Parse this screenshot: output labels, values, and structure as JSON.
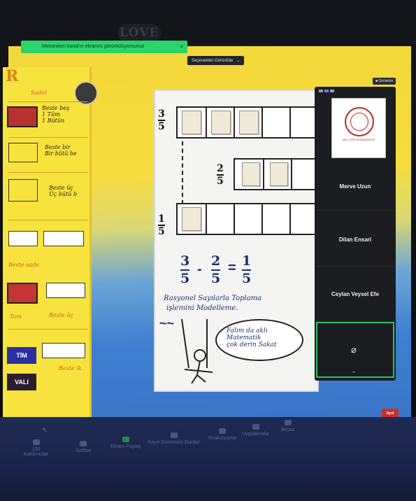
{
  "bezel": {
    "camera_label": "LOVE"
  },
  "zoom_bar": {
    "share_banner": "Mekaniken kanal'ın ekranını görüntülüyorsunuz",
    "share_banner_close": "×",
    "view_options": "Seçenekleri Görüntüle",
    "view_chevron": "⌄",
    "fullscreen_label": "■ Görünüm"
  },
  "left_board": {
    "big_letter": "R",
    "header": "Sadel",
    "rows": [
      {
        "label": "Beste beş\n1 Tüm\n1 Bütün"
      },
      {
        "label": "Beste bir\nBir bütü be"
      },
      {
        "label": "Beste üç\nÜç bütü b"
      },
      {
        "label": "Beste sade"
      },
      {
        "label": "Beste üç"
      },
      {
        "label": "Beste ik"
      }
    ],
    "tm_label": "TİM",
    "val_label": "VALI",
    "tom_label": "Tom"
  },
  "whiteboard": {
    "fractions": [
      {
        "num": "3",
        "den": "5"
      },
      {
        "num": "2",
        "den": "5"
      },
      {
        "num": "1",
        "den": "5"
      }
    ],
    "equation": {
      "a": {
        "num": "3",
        "den": "5"
      },
      "op1": "-",
      "b": {
        "num": "2",
        "den": "5"
      },
      "op2": "=",
      "c": {
        "num": "1",
        "den": "5"
      }
    },
    "note_line1": "Rasyonel Sayılarla Toplama",
    "note_line2": "işlemini Modelleme.",
    "thought": "Falım da aklı\nMatematik\nçok derin Sakat",
    "waves": "~~"
  },
  "participants": {
    "logo_caption": "MİLLİ EĞİTİM BAKANLIĞI",
    "names": [
      "Merve Uzun",
      "Dilan Ensari",
      "Ceylan Veysel Efe"
    ],
    "camera_icon": "⌀",
    "scroll_icon": "⌄"
  },
  "end_button": "Ayrıl",
  "toolbar": {
    "items": [
      {
        "label": "Katılımcılar",
        "count": "100"
      },
      {
        "label": "Sohbet"
      },
      {
        "label": "Ekranı Paylaş"
      },
      {
        "label": "Kayıt Sürümünü Durdur"
      },
      {
        "label": "Reaksiyonlar"
      },
      {
        "label": "Uygulamalar"
      },
      {
        "label": "Beyaz"
      }
    ],
    "arrow": "↖"
  }
}
